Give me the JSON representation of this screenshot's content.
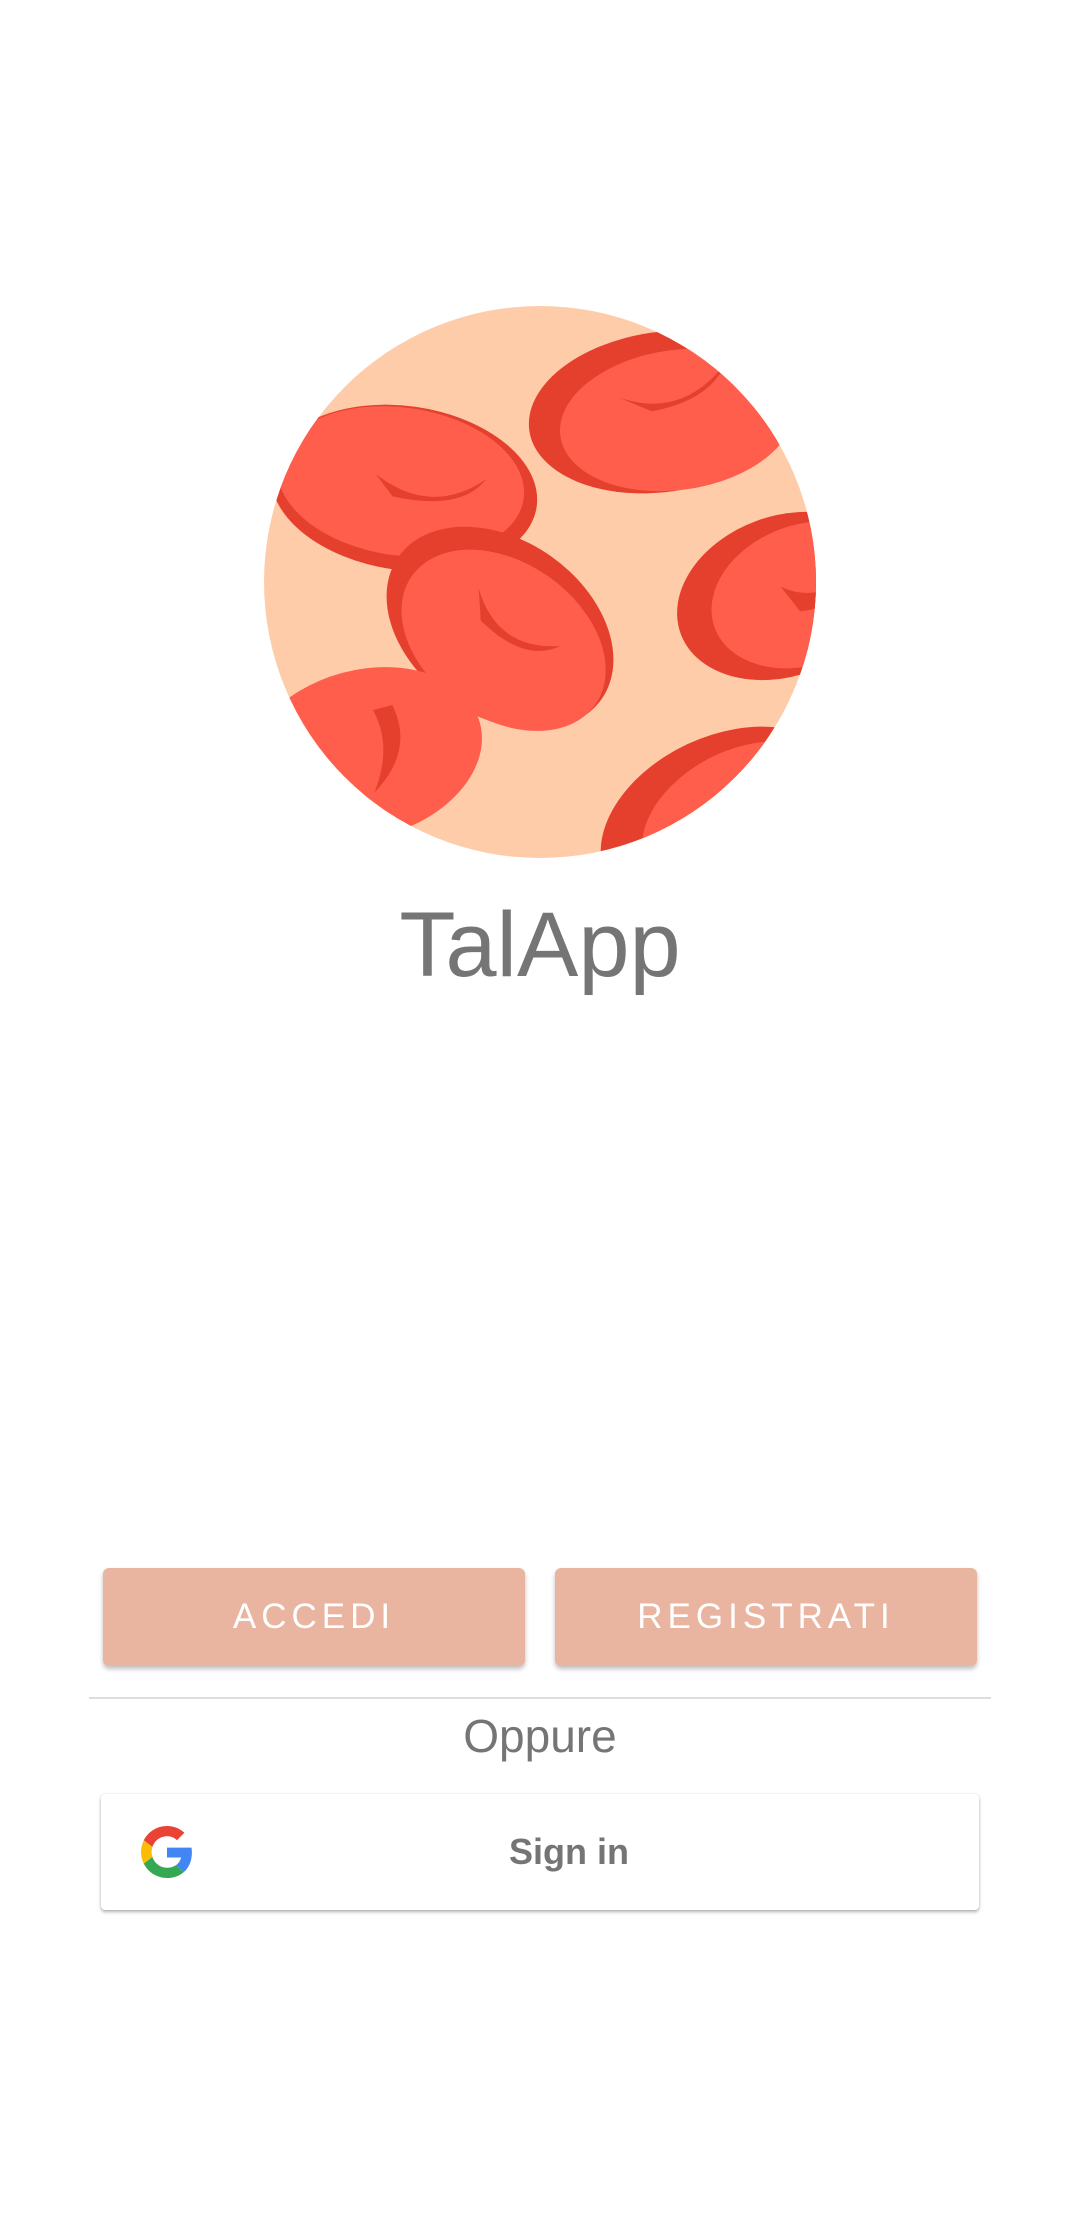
{
  "app": {
    "title": "TalApp",
    "logo_icon": "red-blood-cells-icon"
  },
  "actions": {
    "login_label": "ACCEDI",
    "register_label": "REGISTRATI"
  },
  "separator": {
    "or_text": "Oppure"
  },
  "google_signin": {
    "label": "Sign in",
    "icon": "google-g-icon"
  },
  "colors": {
    "button_bg": "#e9b5a0",
    "logo_bg": "#ffccaa",
    "cell_light": "#ff5e4c",
    "cell_dark": "#e5402e",
    "text_gray": "#757575"
  }
}
